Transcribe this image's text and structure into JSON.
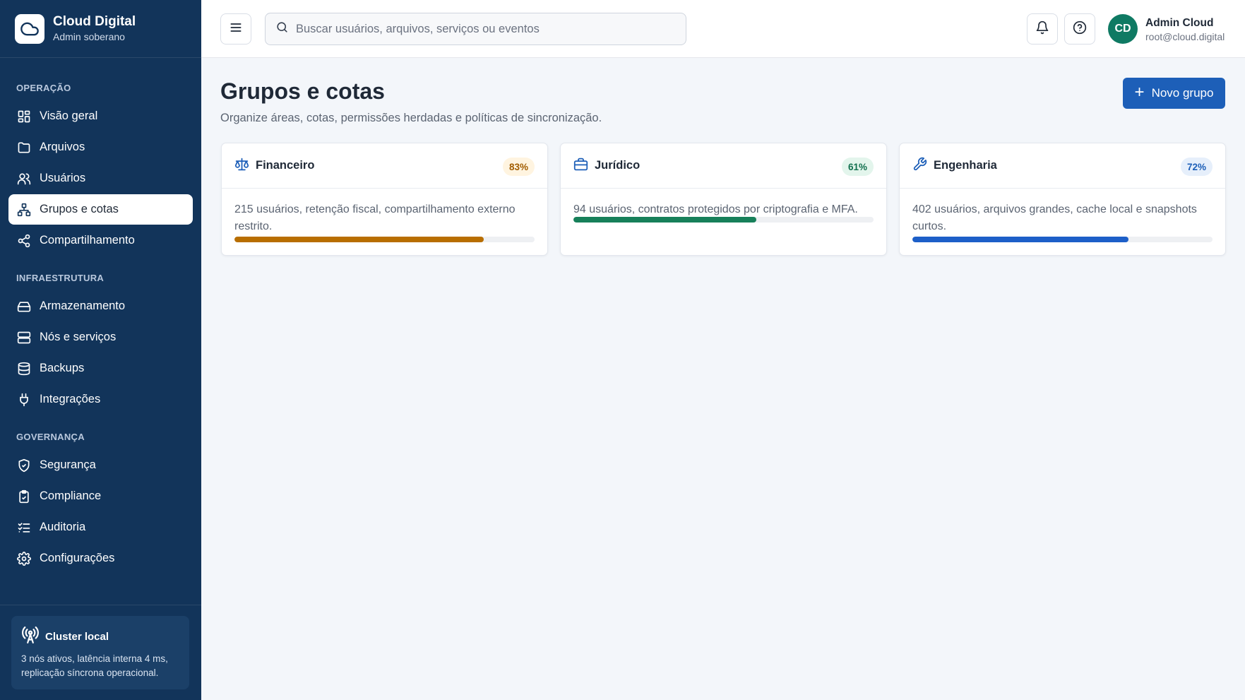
{
  "brand": {
    "title": "Cloud Digital",
    "subtitle": "Admin soberano"
  },
  "sidebar": {
    "sections": [
      {
        "label": "OPERAÇÃO",
        "items": [
          {
            "label": "Visão geral",
            "icon": "dashboard-icon"
          },
          {
            "label": "Arquivos",
            "icon": "folder-icon"
          },
          {
            "label": "Usuários",
            "icon": "users-icon"
          },
          {
            "label": "Grupos e cotas",
            "icon": "network-icon",
            "active": true
          },
          {
            "label": "Compartilhamento",
            "icon": "share-icon"
          }
        ]
      },
      {
        "label": "INFRAESTRUTURA",
        "items": [
          {
            "label": "Armazenamento",
            "icon": "hard-drive-icon"
          },
          {
            "label": "Nós e serviços",
            "icon": "server-icon"
          },
          {
            "label": "Backups",
            "icon": "database-icon"
          },
          {
            "label": "Integrações",
            "icon": "plug-icon"
          }
        ]
      },
      {
        "label": "GOVERNANÇA",
        "items": [
          {
            "label": "Segurança",
            "icon": "shield-icon"
          },
          {
            "label": "Compliance",
            "icon": "clipboard-check-icon"
          },
          {
            "label": "Auditoria",
            "icon": "list-checks-icon"
          },
          {
            "label": "Configurações",
            "icon": "gear-icon"
          }
        ]
      }
    ],
    "cluster": {
      "title": "Cluster local",
      "description": "3 nós ativos, latência interna 4 ms, replicação síncrona operacional."
    }
  },
  "topbar": {
    "search_placeholder": "Buscar usuários, arquivos, serviços ou eventos",
    "user": {
      "initials": "CD",
      "name": "Admin Cloud",
      "email": "root@cloud.digital"
    }
  },
  "main": {
    "title": "Grupos e cotas",
    "subtitle": "Organize áreas, cotas, permissões herdadas e políticas de sincronização.",
    "new_button": "Novo grupo",
    "groups": [
      {
        "name": "Financeiro",
        "icon": "scale-icon",
        "badge": "83%",
        "usage": 0.83,
        "description": "215 usuários, retenção fiscal, compartilhamento externo restrito.",
        "color": "#b86e00",
        "badge_bg": "#fff4e0",
        "badge_color": "#a15c00"
      },
      {
        "name": "Jurídico",
        "icon": "briefcase-icon",
        "badge": "61%",
        "usage": 0.61,
        "description": "94 usuários, contratos protegidos por criptografia e MFA.",
        "color": "#17805a",
        "badge_bg": "#e3f5ec",
        "badge_color": "#13714f"
      },
      {
        "name": "Engenharia",
        "icon": "wrench-icon",
        "badge": "72%",
        "usage": 0.72,
        "description": "402 usuários, arquivos grandes, cache local e snapshots curtos.",
        "color": "#1d5fc8",
        "badge_bg": "#e6effb",
        "badge_color": "#1d5fb8"
      }
    ]
  }
}
